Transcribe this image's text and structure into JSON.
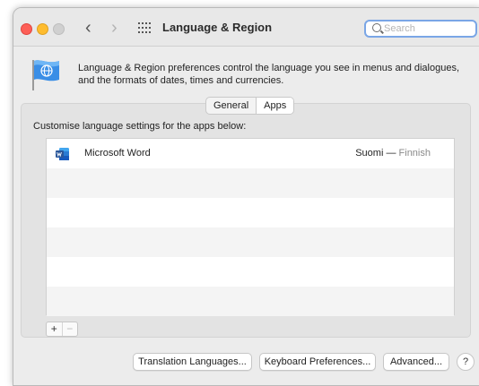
{
  "window": {
    "title": "Language & Region",
    "nav_back": "‹",
    "nav_forward": "›"
  },
  "search": {
    "placeholder": "Search",
    "value": ""
  },
  "header": {
    "description": "Language & Region preferences control the language you see in menus and dialogues, and the formats of dates, times and currencies."
  },
  "tabs": [
    {
      "label": "General",
      "selected": false
    },
    {
      "label": "Apps",
      "selected": true
    }
  ],
  "apps_panel": {
    "hint": "Customise language settings for the apps below:",
    "apps": [
      {
        "name": "Microsoft Word",
        "language": "Suomi",
        "separator": " — ",
        "language_en": "Finnish",
        "icon": "microsoft-word-icon"
      }
    ],
    "add_label": "+",
    "remove_label": "−"
  },
  "buttons": {
    "translation": "Translation Languages...",
    "keyboard": "Keyboard Preferences...",
    "advanced": "Advanced...",
    "help": "?"
  },
  "colors": {
    "close": "#fd5f57",
    "minimize": "#febc2e",
    "zoom": "#d0d0d0",
    "focus_ring": "#7aa6e6",
    "word_blue": "#2b579a"
  }
}
